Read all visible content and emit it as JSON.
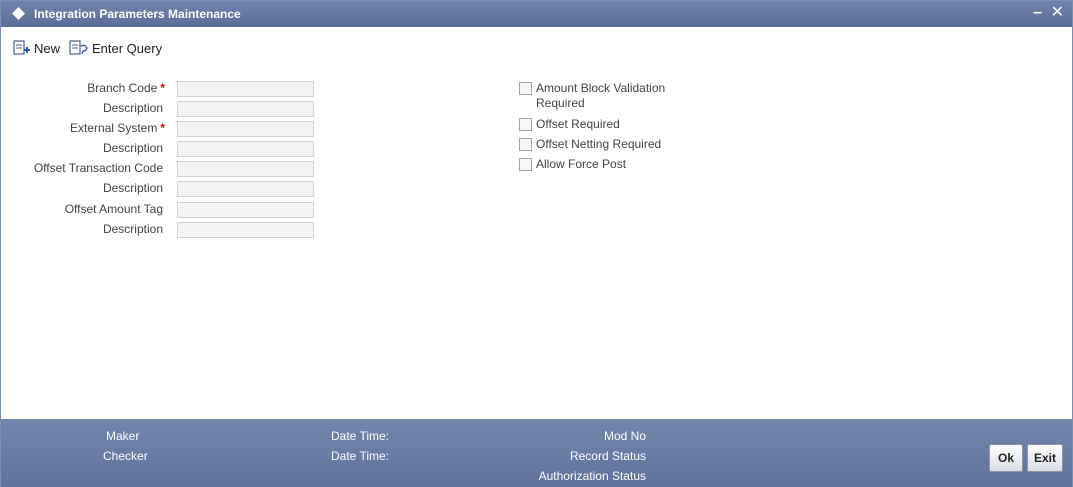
{
  "window": {
    "title": "Integration Parameters Maintenance",
    "minimize": "–",
    "close": "✕"
  },
  "toolbar": {
    "new_label": "New",
    "enter_query_label": "Enter Query"
  },
  "form": {
    "branch_code": {
      "label": "Branch Code",
      "value": "",
      "required": "*"
    },
    "branch_description": {
      "label": "Description",
      "value": ""
    },
    "external_system": {
      "label": "External System",
      "value": "",
      "required": "*"
    },
    "external_description": {
      "label": "Description",
      "value": ""
    },
    "offset_transaction_code": {
      "label": "Offset Transaction Code",
      "value": ""
    },
    "offset_txn_description": {
      "label": "Description",
      "value": ""
    },
    "offset_amount_tag": {
      "label": "Offset Amount Tag",
      "value": ""
    },
    "offset_amount_description": {
      "label": "Description",
      "value": ""
    }
  },
  "checkboxes": {
    "amount_block_validation": {
      "label": "Amount Block Validation Required",
      "checked": false
    },
    "offset_required": {
      "label": "Offset Required",
      "checked": false
    },
    "offset_netting_required": {
      "label": "Offset Netting Required",
      "checked": false
    },
    "allow_force_post": {
      "label": "Allow Force Post",
      "checked": false
    }
  },
  "footer": {
    "maker_label": "Maker",
    "checker_label": "Checker",
    "maker_datetime_label": "Date Time:",
    "checker_datetime_label": "Date Time:",
    "mod_no_label": "Mod No",
    "record_status_label": "Record Status",
    "authorization_status_label": "Authorization Status",
    "ok_label": "Ok",
    "exit_label": "Exit"
  },
  "colors": {
    "titlebar": "#5a6d98",
    "footer": "#6a7da6",
    "required": "#d40000",
    "field_bg": "#f3f3f3"
  },
  "icons": {
    "title": "diamond-icon",
    "new": "new-document-icon",
    "enter_query": "query-document-icon"
  }
}
